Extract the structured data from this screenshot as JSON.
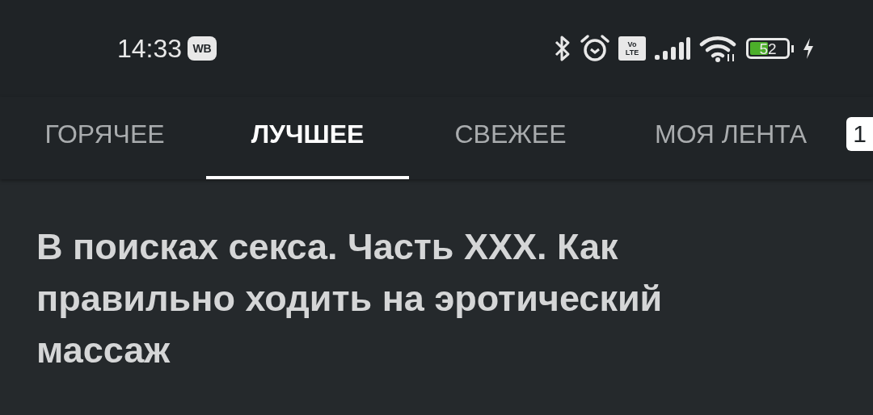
{
  "status_bar": {
    "time": "14:33",
    "app_badge": "WB",
    "volte": [
      "Vo",
      "LTE"
    ],
    "battery": "52"
  },
  "tabs": [
    {
      "label": "ГОРЯЧЕЕ",
      "selected": false
    },
    {
      "label": "ЛУЧШЕЕ",
      "selected": true
    },
    {
      "label": "СВЕЖЕЕ",
      "selected": false
    },
    {
      "label": "МОЯ ЛЕНТА",
      "selected": false,
      "badge": "1"
    }
  ],
  "post": {
    "title": "В поисках секса. Часть XXX. Как правильно ходить на эротический массаж"
  }
}
